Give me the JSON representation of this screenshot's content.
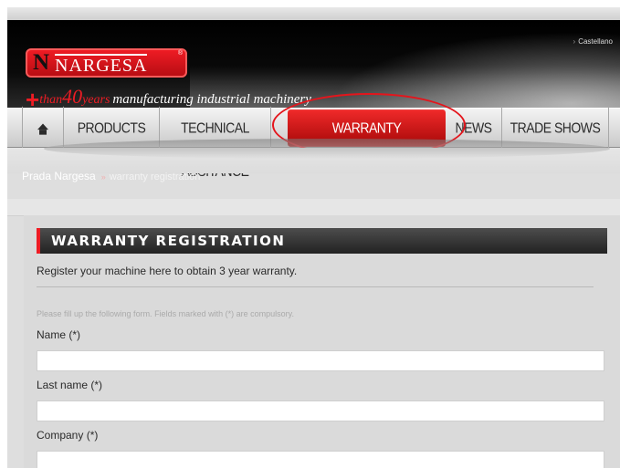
{
  "header": {
    "language": "Castellano",
    "logo_letter": "N",
    "logo_word": "NARGESA",
    "logo_reg": "®",
    "tagline": {
      "plus": "+",
      "than": "than",
      "number": "40",
      "years": "years",
      "rest": "manufacturing industrial machinery"
    }
  },
  "nav": {
    "items": [
      {
        "label": "PRODUCTS"
      },
      {
        "label": "TECHNICAL ASSITANCE"
      },
      {
        "label": "WARRANTY REGISTRATION"
      },
      {
        "label": "NEWS"
      },
      {
        "label": "TRADE SHOWS"
      }
    ],
    "home_icon": "home-icon",
    "active_index": 2
  },
  "breadcrumb": {
    "root": "Prada Nargesa",
    "separator": "»",
    "current": "warranty registration"
  },
  "form": {
    "title": "WARRANTY REGISTRATION",
    "intro": "Register your machine here to obtain 3 year warranty.",
    "help": "Please fill up the following form. Fields marked with (*) are compulsory.",
    "fields": [
      {
        "label": "Name (*)",
        "value": ""
      },
      {
        "label": "Last name (*)",
        "value": ""
      },
      {
        "label": "Company (*)",
        "value": ""
      }
    ]
  },
  "colors": {
    "brand_red": "#ee1c24",
    "header_black": "#000000",
    "page_gray": "#dadada"
  }
}
